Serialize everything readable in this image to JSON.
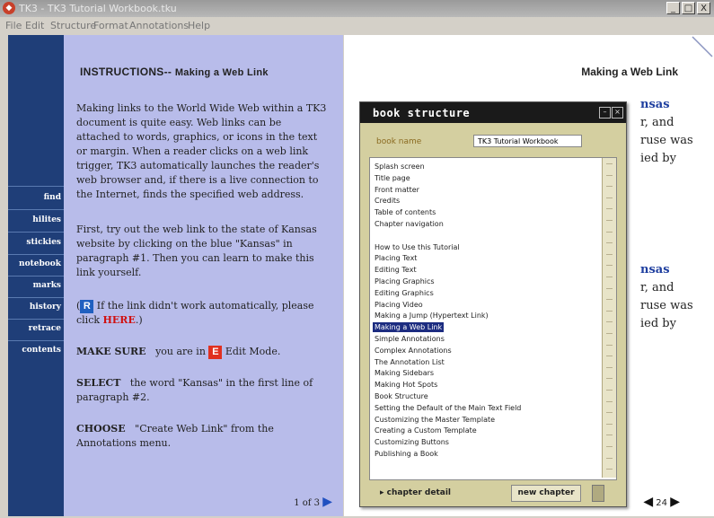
{
  "window": {
    "title": "TK3 - TK3 Tutorial Workbook.tku",
    "minimize": "_",
    "maximize": "□",
    "close": "X"
  },
  "menu": [
    "File",
    "Edit",
    "Structure",
    "Format",
    "Annotations",
    "Help"
  ],
  "sidebar": {
    "items": [
      "find",
      "hilites",
      "stickies",
      "notebook",
      "marks",
      "history",
      "retrace",
      "contents"
    ]
  },
  "instructions": {
    "heading": "INSTRUCTIONS--",
    "heading_sub": "Making a Web Link",
    "para1": "Making links to the World Wide Web within a TK3 document is quite easy. Web links can be attached to words, graphics, or icons in the text or margin. When a reader clicks on a web link trigger, TK3 automatically launches the reader's web browser and, if there is a live connection to the Internet, finds the specified web address.",
    "para2": "First, try out the web link to the state of Kansas website by clicking on the blue \"Kansas\" in paragraph #1. Then you can learn to make this link yourself.",
    "para3_open": "(",
    "para3_badge": "R",
    "para3_text": " If the link didn't work automatically, please click ",
    "para3_link": "HERE",
    "para3_close": ".)",
    "make_sure_label": "MAKE SURE",
    "make_sure_pre": "you are in",
    "make_sure_badge": "E",
    "make_sure_post": "Edit Mode.",
    "select_label": "SELECT",
    "select_text": "the word \"Kansas\" in the first line of paragraph #2.",
    "choose_label": "CHOOSE",
    "choose_text": "\"Create Web Link\" from the Annotations menu.",
    "pager": "1 of 3"
  },
  "page": {
    "title": "Making a Web Link",
    "page_number": "24",
    "frag1": [
      "nsas",
      "r, and",
      "ruse was",
      "ied by"
    ],
    "frag2": [
      "nsas",
      "r, and",
      "ruse was",
      "ied by"
    ]
  },
  "dialog": {
    "title": "book structure",
    "book_name_label": "book name",
    "book_name_value": "TK3 Tutorial Workbook",
    "items": [
      "Splash screen",
      "Title page",
      "Front matter",
      "Credits",
      "Table of contents",
      "Chapter navigation",
      "",
      "How to Use this Tutorial",
      "Placing Text",
      "Editing Text",
      "Placing Graphics",
      "Editing Graphics",
      "Placing Video",
      "Making a Jump (Hypertext Link)",
      "Making a Web Link",
      "Simple Annotations",
      "Complex Annotations",
      "The Annotation List",
      "Making Sidebars",
      "Making Hot Spots",
      "Book Structure",
      "Setting the Default of the Main Text Field",
      "Customizing the Master Template",
      "Creating a Custom Template",
      "Customizing Buttons",
      "Publishing a Book"
    ],
    "selected_index": 14,
    "chapter_detail": "chapter detail",
    "new_chapter": "new chapter"
  }
}
